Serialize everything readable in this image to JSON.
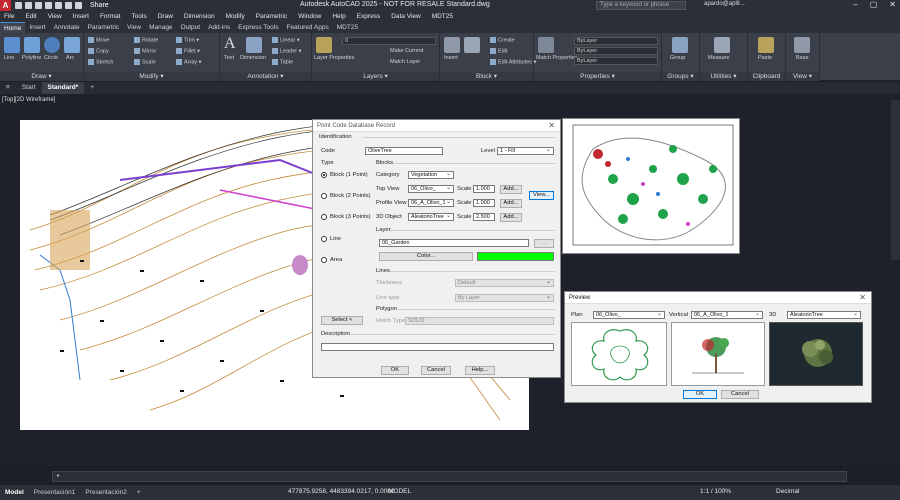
{
  "titlebar": {
    "app_logo": "A",
    "share_label": "Share",
    "title": "Autodesk AutoCAD 2025 - NOT FOR RESALE   Standard.dwg",
    "search_placeholder": "Type a keyword or phrase",
    "user": "apardo@aplit...",
    "window_controls": [
      "–",
      "▢",
      "✕"
    ]
  },
  "menubar": {
    "items": [
      "File",
      "Edit",
      "View",
      "Insert",
      "Format",
      "Tools",
      "Draw",
      "Dimension",
      "Modify",
      "Parametric",
      "Window",
      "Help",
      "Express",
      "Data View",
      "MDT25"
    ]
  },
  "ribbon_tabs": {
    "items": [
      "Home",
      "Insert",
      "Annotate",
      "Parametric",
      "View",
      "Manage",
      "Output",
      "Add-ins",
      "Express Tools",
      "Featured Apps",
      "MDT25"
    ],
    "active": "Home"
  },
  "ribbon": {
    "draw": {
      "title": "Draw ▾",
      "line": "Line",
      "polyline": "Polyline",
      "circle": "Circle",
      "arc": "Arc"
    },
    "modify": {
      "title": "Modify ▾",
      "move": "Move",
      "rotate": "Rotate",
      "trim": "Trim ▾",
      "copy": "Copy",
      "mirror": "Mirror",
      "fillet": "Fillet ▾",
      "stretch": "Stretch",
      "scale": "Scale",
      "array": "Array ▾"
    },
    "annotation": {
      "title": "Annotation ▾",
      "text": "Text",
      "dimension": "Dimension",
      "linear": "Linear ▾",
      "leader": "Leader ▾",
      "table": "Table"
    },
    "layers": {
      "title": "Layers ▾",
      "layer_properties": "Layer Properties",
      "make_current": "Make Current",
      "match_layer": "Match Layer",
      "current_layer": "0"
    },
    "block": {
      "title": "Block ▾",
      "insert": "Insert",
      "create": "Create",
      "edit": "Edit",
      "edit_attributes": "Edit Attributes ▾"
    },
    "properties": {
      "title": "Properties ▾",
      "match_properties": "Match Properties",
      "by_layer_1": "ByLayer",
      "by_layer_2": "ByLayer",
      "by_layer_3": "ByLayer"
    },
    "groups": {
      "title": "Groups ▾",
      "label": "Group"
    },
    "utilities": {
      "title": "Utilities ▾",
      "measure": "Measure"
    },
    "clipboard": {
      "title": "Clipboard",
      "paste": "Paste"
    },
    "view": {
      "title": "View ▾",
      "base": "Base"
    }
  },
  "doc_tabs": {
    "items": [
      "Start",
      "Standard*"
    ],
    "active": "Standard*",
    "add": "+",
    "menu": "≡"
  },
  "viewport_label": "[Top][2D Wireframe]",
  "dialog_pcdb": {
    "title": "Point Code Database Record",
    "identification_label": "Identification",
    "code_label": "Code",
    "code_value": "OliveTree",
    "level_label": "Level",
    "level_value": "1 - Fill",
    "type_label": "Type",
    "types": [
      "Block  (1 Point)",
      "Block (2 Points)",
      "Block (3 Points)",
      "Line",
      "Area"
    ],
    "selected_type": 0,
    "select_button": "Select <",
    "blocks_label": "Blocks",
    "category_label": "Category",
    "category_value": "Vegetation",
    "top_view_label": "Top View",
    "top_view_value": "06_Olivo_",
    "profile_view_label": "Profile View",
    "profile_view_value": "06_A_Olivo_1",
    "object3d_label": "3D Object",
    "object3d_value": "AleatorioTree",
    "scale_label": "Scale",
    "scale_top": "1.000",
    "scale_profile": "1.000",
    "scale_3d": "2.500",
    "add_label": "Add...",
    "view_button": "View...",
    "layer_group_label": "Layer",
    "layer_value": "06_Garden",
    "layer_browse": "...",
    "color_button": "Color...",
    "color_swatch": "#00ff00",
    "lines_label": "Lines",
    "thickness_label": "Thickness",
    "thickness_value": "Default",
    "linetype_label": "Line type",
    "linetype_value": "By Layer",
    "polygon_label": "Polygon",
    "hatch_label": "Hatch Type",
    "hatch_value": "SOLID",
    "description_label": "Description",
    "description_value": "",
    "ok": "OK",
    "cancel": "Cancel",
    "help": "Help..."
  },
  "dialog_preview": {
    "title": "Preview",
    "plan_label": "Plan",
    "plan_value": "06_Olivo_",
    "vertical_label": "Vertical",
    "vertical_value": "06_A_Olivo_1",
    "label_3d": "3D",
    "value_3d": "AleatorioTree",
    "ok": "OK",
    "cancel": "Cancel"
  },
  "command_line": {
    "placeholder": "▸"
  },
  "statusbar": {
    "tabs": [
      "Model",
      "Presentación1",
      "Presentación2"
    ],
    "active_tab": "Model",
    "add": "+",
    "coords": "477875.9258, 4483394.0217, 0.0000",
    "mode": "MODEL",
    "scale": "1:1 / 100%",
    "units": "Decimal"
  },
  "colors": {
    "accent": "#3f8fd6",
    "dialog_bg": "#f0f0f0",
    "app_dark": "#2b2f38"
  }
}
